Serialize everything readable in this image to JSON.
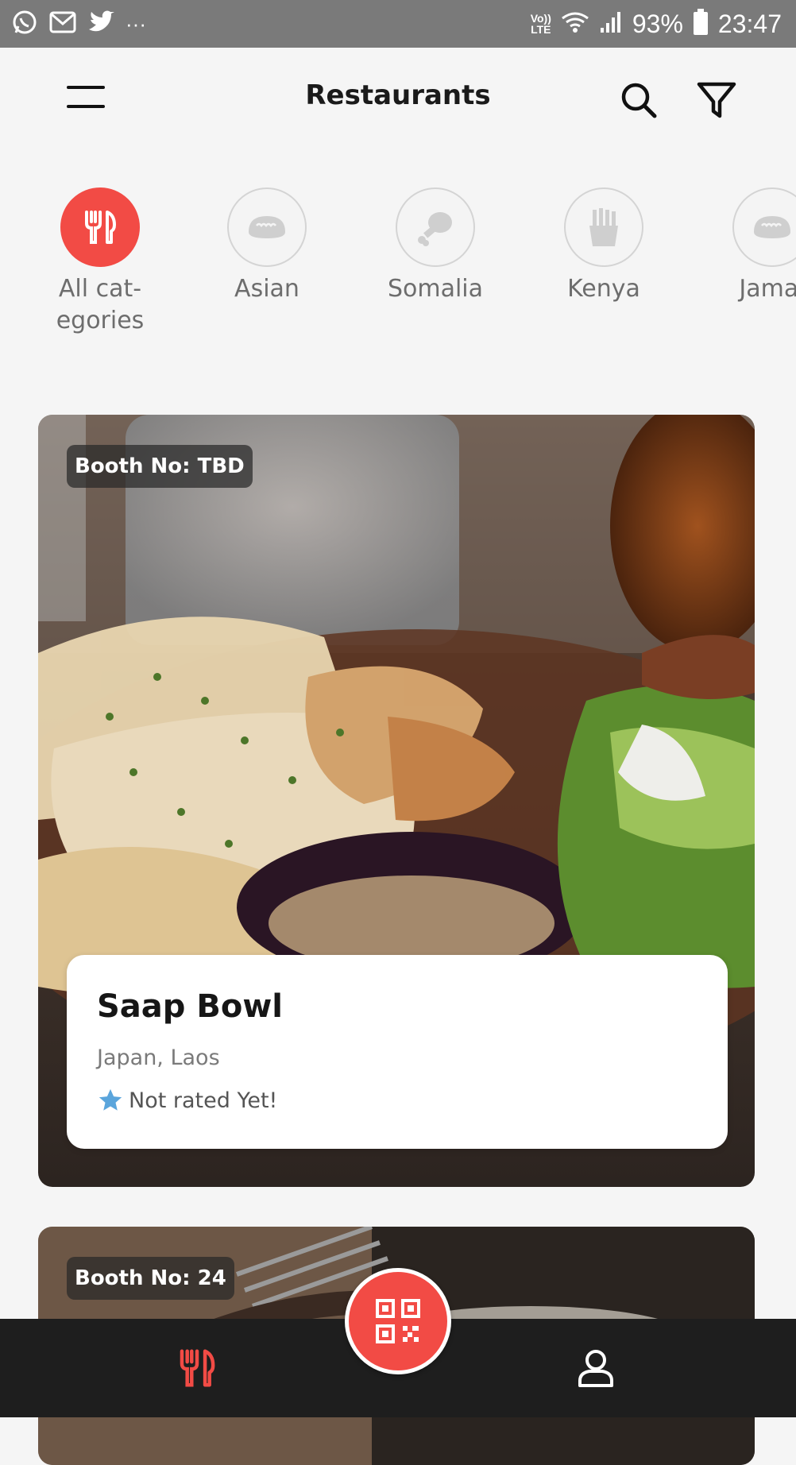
{
  "status_bar": {
    "battery": "93%",
    "time": "23:47",
    "volte_top": "Vo))",
    "volte_bottom": "LTE",
    "more_indicator": "···"
  },
  "header": {
    "title": "Restaurants"
  },
  "categories": [
    {
      "label": "All cat-\negories",
      "icon": "cutlery-icon",
      "active": true
    },
    {
      "label": "Asian",
      "icon": "dumpling-icon",
      "active": false
    },
    {
      "label": "Somalia",
      "icon": "meat-leg-icon",
      "active": false
    },
    {
      "label": "Kenya",
      "icon": "fries-icon",
      "active": false
    },
    {
      "label": "Jamai",
      "icon": "dumpling-icon",
      "active": false
    }
  ],
  "restaurants": [
    {
      "booth": "Booth No: TBD",
      "name": "Saap Bowl",
      "location": "Japan, Laos",
      "rating": "Not rated Yet!"
    },
    {
      "booth": "Booth No: 24"
    }
  ],
  "colors": {
    "accent": "#f24b45",
    "star": "#5aa5dc",
    "nav_background": "#1e1e1e"
  }
}
